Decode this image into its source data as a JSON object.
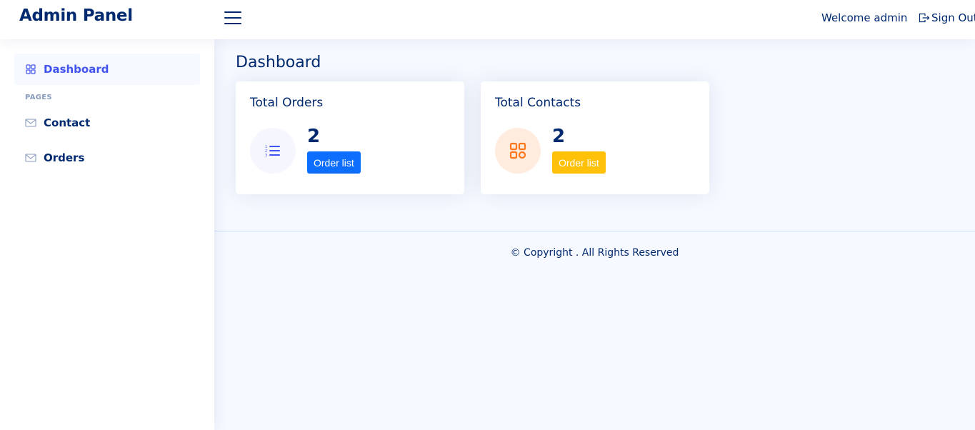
{
  "header": {
    "logo": "Admin Panel",
    "welcome": "Welcome admin",
    "signout_label": "Sign Out"
  },
  "sidebar": {
    "items": [
      {
        "label": "Dashboard",
        "icon": "grid-icon",
        "active": true
      },
      {
        "label": "Contact",
        "icon": "envelope-icon"
      },
      {
        "label": "Orders",
        "icon": "envelope-icon"
      }
    ],
    "heading": "PAGES"
  },
  "main": {
    "title": "Dashboard",
    "cards": [
      {
        "title": "Total Orders",
        "value": "2",
        "button": "Order list",
        "icon": "list-ol-icon",
        "icon_color": "#4154f1",
        "icon_bg": "#f6f6fe",
        "button_color": "#0d6efd"
      },
      {
        "title": "Total Contacts",
        "value": "2",
        "button": "Order list",
        "icon": "grid-icon",
        "icon_color": "#ff771d",
        "icon_bg": "#ffecdf",
        "button_color": "#ffc107"
      }
    ]
  },
  "footer": {
    "text": "© Copyright . All Rights Reserved"
  }
}
